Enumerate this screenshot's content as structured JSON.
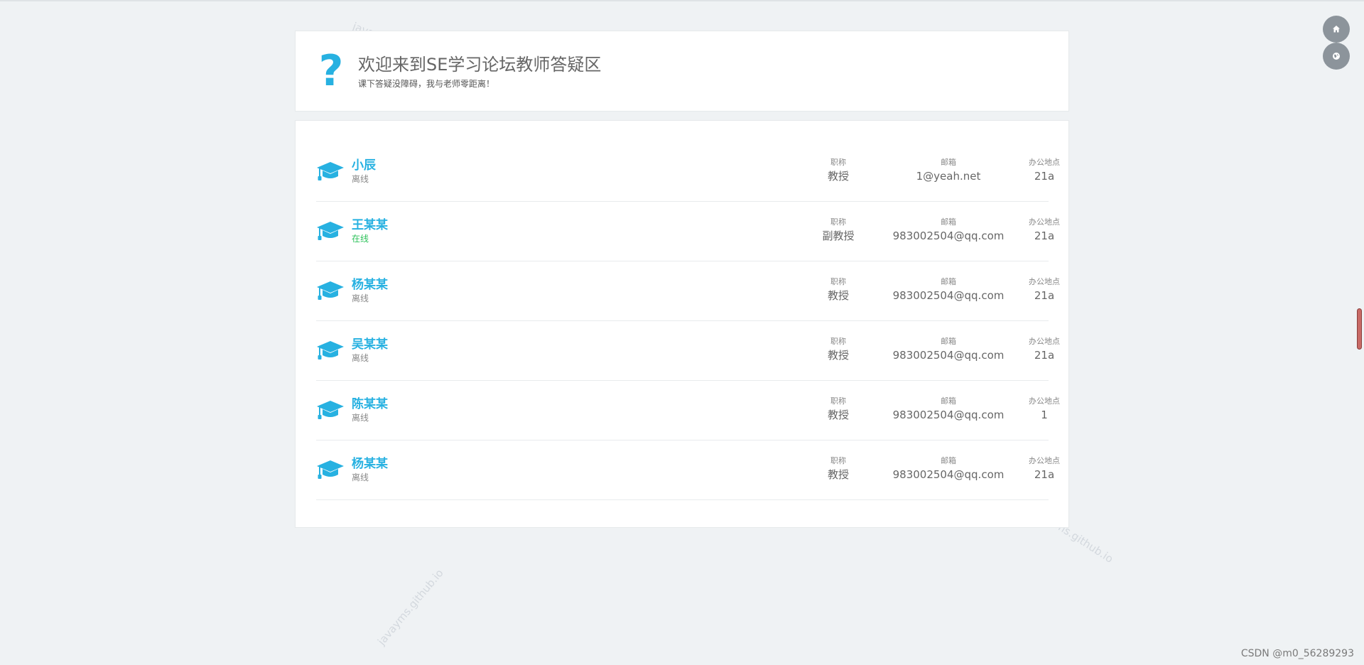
{
  "header": {
    "icon": "question-mark-icon",
    "title": "欢迎来到SE学习论坛教师答疑区",
    "subtitle": "课下答疑没障碍，我与老师零距离！"
  },
  "columns": {
    "title_label": "职称",
    "email_label": "邮箱",
    "office_label": "办公地点"
  },
  "teachers": [
    {
      "name": "小辰",
      "status": "离线",
      "online": false,
      "title": "教授",
      "email": "1@yeah.net",
      "office": "21a"
    },
    {
      "name": "王某某",
      "status": "在线",
      "online": true,
      "title": "副教授",
      "email": "983002504@qq.com",
      "office": "21a"
    },
    {
      "name": "杨某某",
      "status": "离线",
      "online": false,
      "title": "教授",
      "email": "983002504@qq.com",
      "office": "21a"
    },
    {
      "name": "吴某某",
      "status": "离线",
      "online": false,
      "title": "教授",
      "email": "983002504@qq.com",
      "office": "21a"
    },
    {
      "name": "陈某某",
      "status": "离线",
      "online": false,
      "title": "教授",
      "email": "983002504@qq.com",
      "office": "1"
    },
    {
      "name": "杨某某",
      "status": "离线",
      "online": false,
      "title": "教授",
      "email": "983002504@qq.com",
      "office": "21a"
    }
  ],
  "floating_buttons": [
    {
      "icon": "home-icon"
    },
    {
      "icon": "globe-icon"
    }
  ],
  "watermark": "javayms.github.io",
  "footer_credit": "CSDN @m0_56289293",
  "colors": {
    "accent": "#27b1e1",
    "online": "#2ec25b",
    "background": "#eff2f4"
  }
}
